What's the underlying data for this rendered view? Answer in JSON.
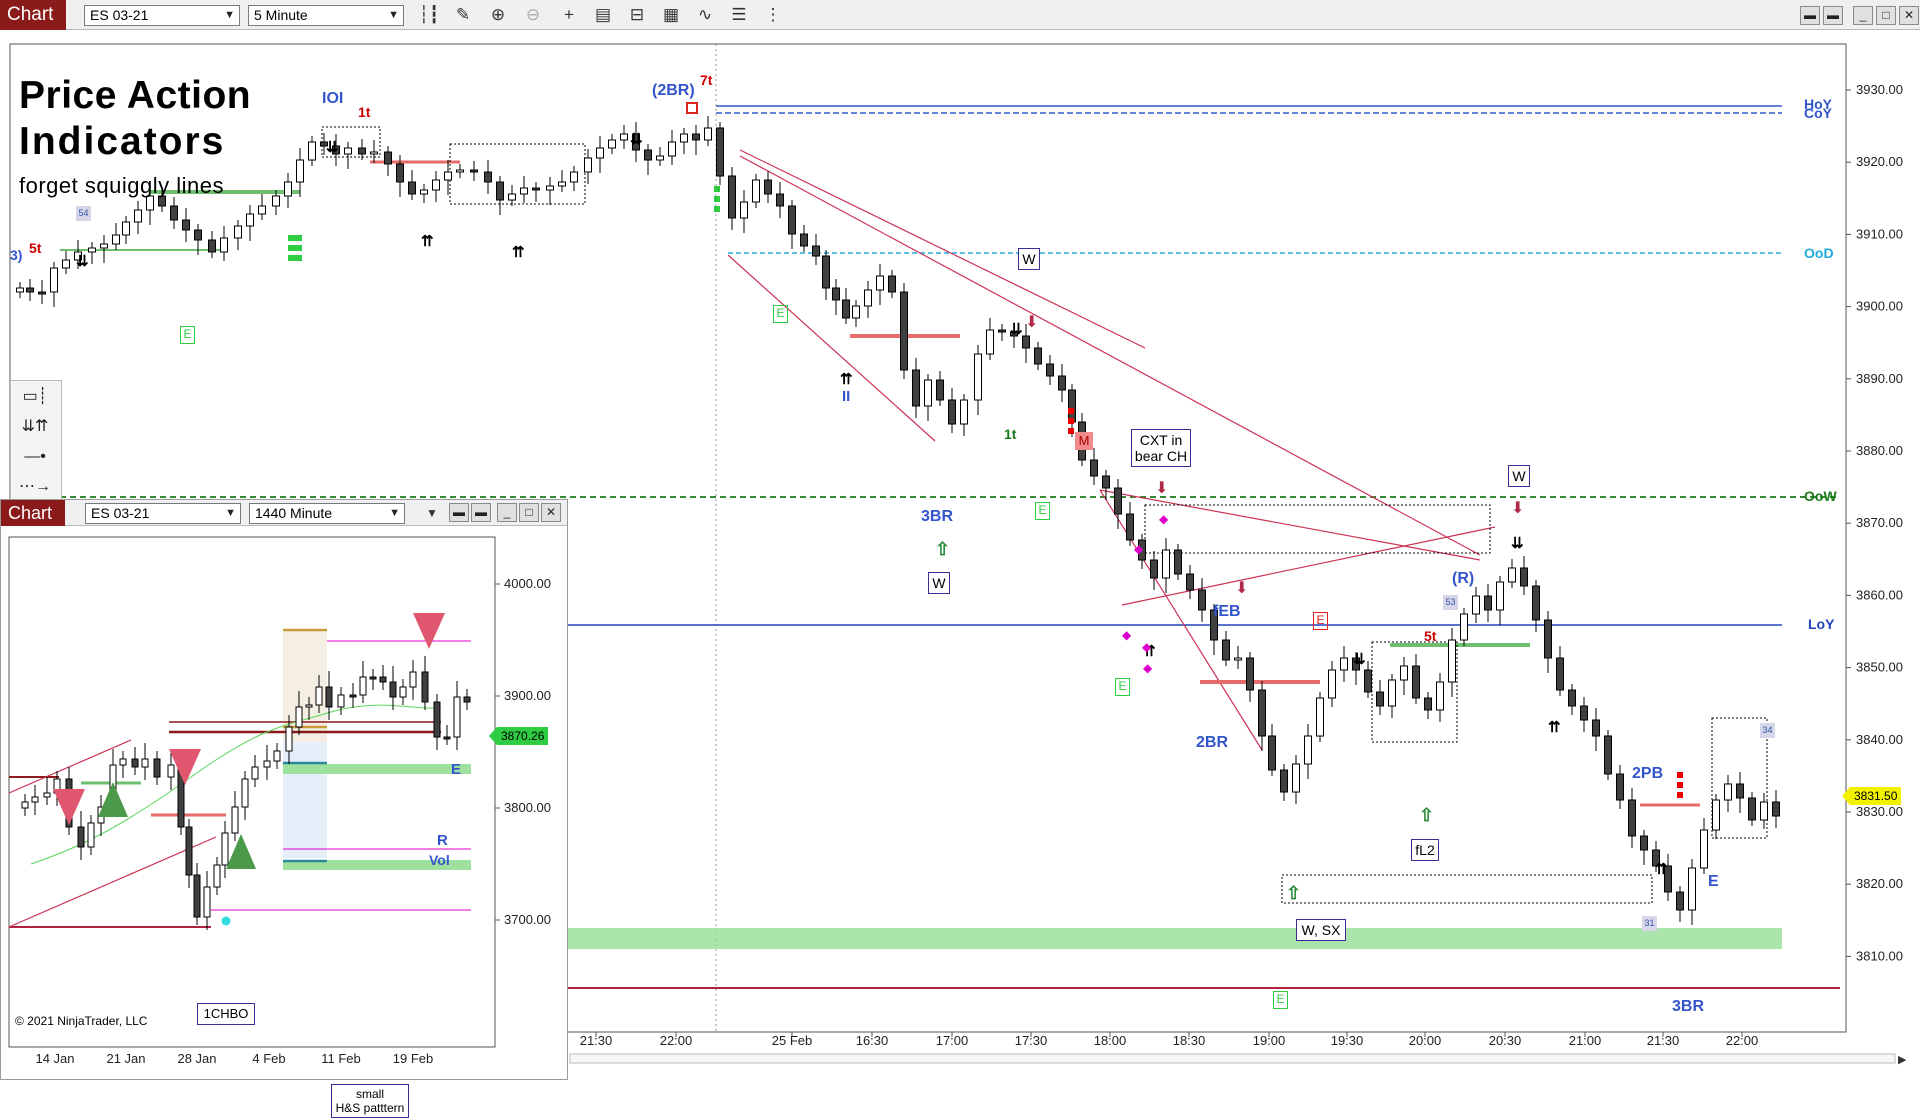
{
  "toolbar": {
    "tab_label": "Chart",
    "instrument": "ES 03-21",
    "interval": "5 Minute"
  },
  "title": {
    "line1": "Price Action",
    "line2": "Indicators",
    "line3": "forget squiggly lines"
  },
  "main_axis": {
    "prices": [
      "3930.00",
      "3920.00",
      "3910.00",
      "3900.00",
      "3890.00",
      "3880.00",
      "3870.00",
      "3860.00",
      "3850.00",
      "3840.00",
      "3830.00",
      "3820.00",
      "3810.00"
    ],
    "times": [
      "21:30",
      "22:00",
      "25 Feb",
      "16:30",
      "17:00",
      "17:30",
      "18:00",
      "18:30",
      "19:00",
      "19:30",
      "20:00",
      "20:30",
      "21:00",
      "21:30",
      "22:00"
    ],
    "last_price": "3831.50",
    "last_price_color": "#f2f200"
  },
  "levels": {
    "hoy": "HoY",
    "coy": "CoY",
    "ood": "OoD",
    "oow": "OoW",
    "loy": "LoY"
  },
  "annotations": {
    "iol": "IOI",
    "t1a": "1t",
    "t5a": "5t",
    "two_br": "(2BR)",
    "t7": "7t",
    "three_br_a": "3BR",
    "w_box_a": "W",
    "w_box_b": "W",
    "w_box_c": "W",
    "ii": "II",
    "t1b": "1t",
    "m": "M",
    "cxt_line1": "CXT in",
    "cxt_line2": "bear CH",
    "feb": "fEB",
    "two_br_b": "2BR",
    "e_green_a": "E",
    "e_green_b": "E",
    "e_green_c": "E",
    "e_green_d": "E",
    "e_green_e": "E",
    "e_red": "E",
    "r_paren": "(R)",
    "t5b": "5t",
    "fl2": "fL2",
    "w_sx": "W, SX",
    "two_pb": "2PB",
    "e_blue": "E",
    "three_br_b": "3BR",
    "num54": "54",
    "num53": "53",
    "num34": "34",
    "num31": "31",
    "three_left": "3)"
  },
  "inset": {
    "tab_label": "Chart",
    "instrument": "ES 03-21",
    "interval": "1440 Minute",
    "prices": [
      "4000.00",
      "3900.00",
      "3800.00",
      "3700.00"
    ],
    "dates": [
      "14 Jan",
      "21 Jan",
      "28 Jan",
      "4 Feb",
      "11 Feb",
      "19 Feb"
    ],
    "last_price": "3870.26",
    "last_price_color": "#2ecc40",
    "small_hs_line1": "small",
    "small_hs_line2": "H&S patttern",
    "one_chbo": "1CHBO",
    "r": "R",
    "vol": "Vol",
    "e": "E",
    "copyright": "© 2021 NinjaTrader, LLC"
  }
}
